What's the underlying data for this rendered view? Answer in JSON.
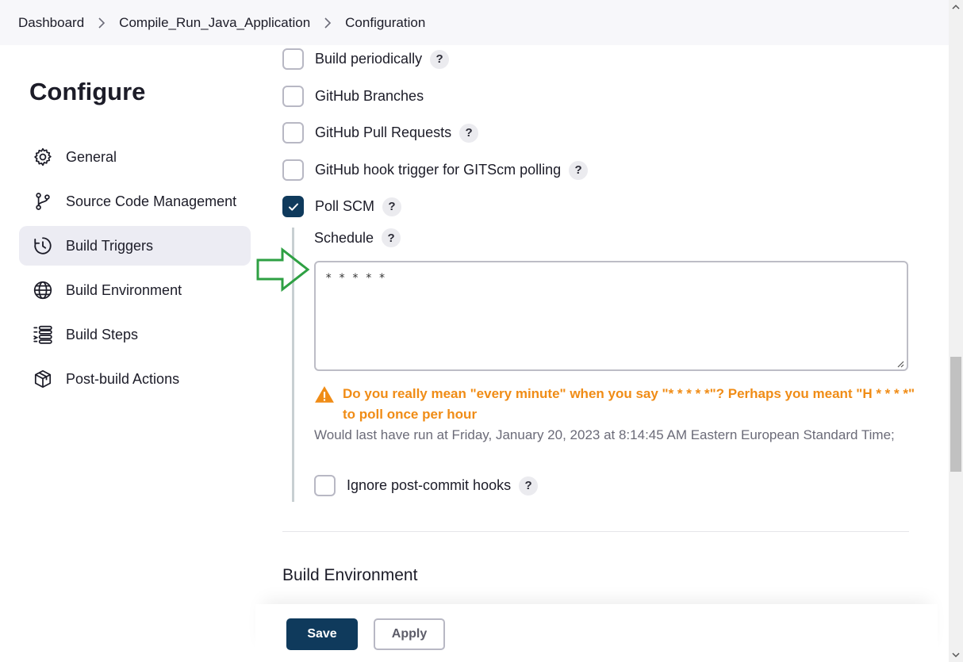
{
  "breadcrumb": {
    "items": [
      "Dashboard",
      "Compile_Run_Java_Application",
      "Configuration"
    ]
  },
  "sidebar": {
    "title": "Configure",
    "items": [
      {
        "label": "General",
        "icon": "gear-icon"
      },
      {
        "label": "Source Code Management",
        "icon": "branch-icon"
      },
      {
        "label": "Build Triggers",
        "icon": "clock-icon",
        "active": true
      },
      {
        "label": "Build Environment",
        "icon": "globe-icon"
      },
      {
        "label": "Build Steps",
        "icon": "list-icon"
      },
      {
        "label": "Post-build Actions",
        "icon": "package-icon"
      }
    ]
  },
  "triggers": {
    "build_periodically": {
      "label": "Build periodically",
      "checked": false,
      "help": "?"
    },
    "github_branches": {
      "label": "GitHub Branches",
      "checked": false
    },
    "github_pull_requests": {
      "label": "GitHub Pull Requests",
      "checked": false,
      "help": "?"
    },
    "github_hook": {
      "label": "GitHub hook trigger for GITScm polling",
      "checked": false,
      "help": "?"
    },
    "poll_scm": {
      "label": "Poll SCM",
      "checked": true,
      "help": "?"
    }
  },
  "schedule": {
    "label": "Schedule",
    "help": "?",
    "value": "* * * * *",
    "warning": "Do you really mean \"every minute\" when you say \"* * * * *\"? Perhaps you meant \"H * * * *\" to poll once per hour",
    "info": "Would last have run at Friday, January 20, 2023 at 8:14:45 AM Eastern European Standard Time;"
  },
  "ignore_post_commit": {
    "label": "Ignore post-commit hooks",
    "checked": false,
    "help": "?"
  },
  "next_section": {
    "title": "Build Environment"
  },
  "buttons": {
    "save": "Save",
    "apply": "Apply"
  },
  "colors": {
    "accent": "#0f3a5c",
    "warning": "#f08c16",
    "annotation_arrow": "#2ea043"
  }
}
